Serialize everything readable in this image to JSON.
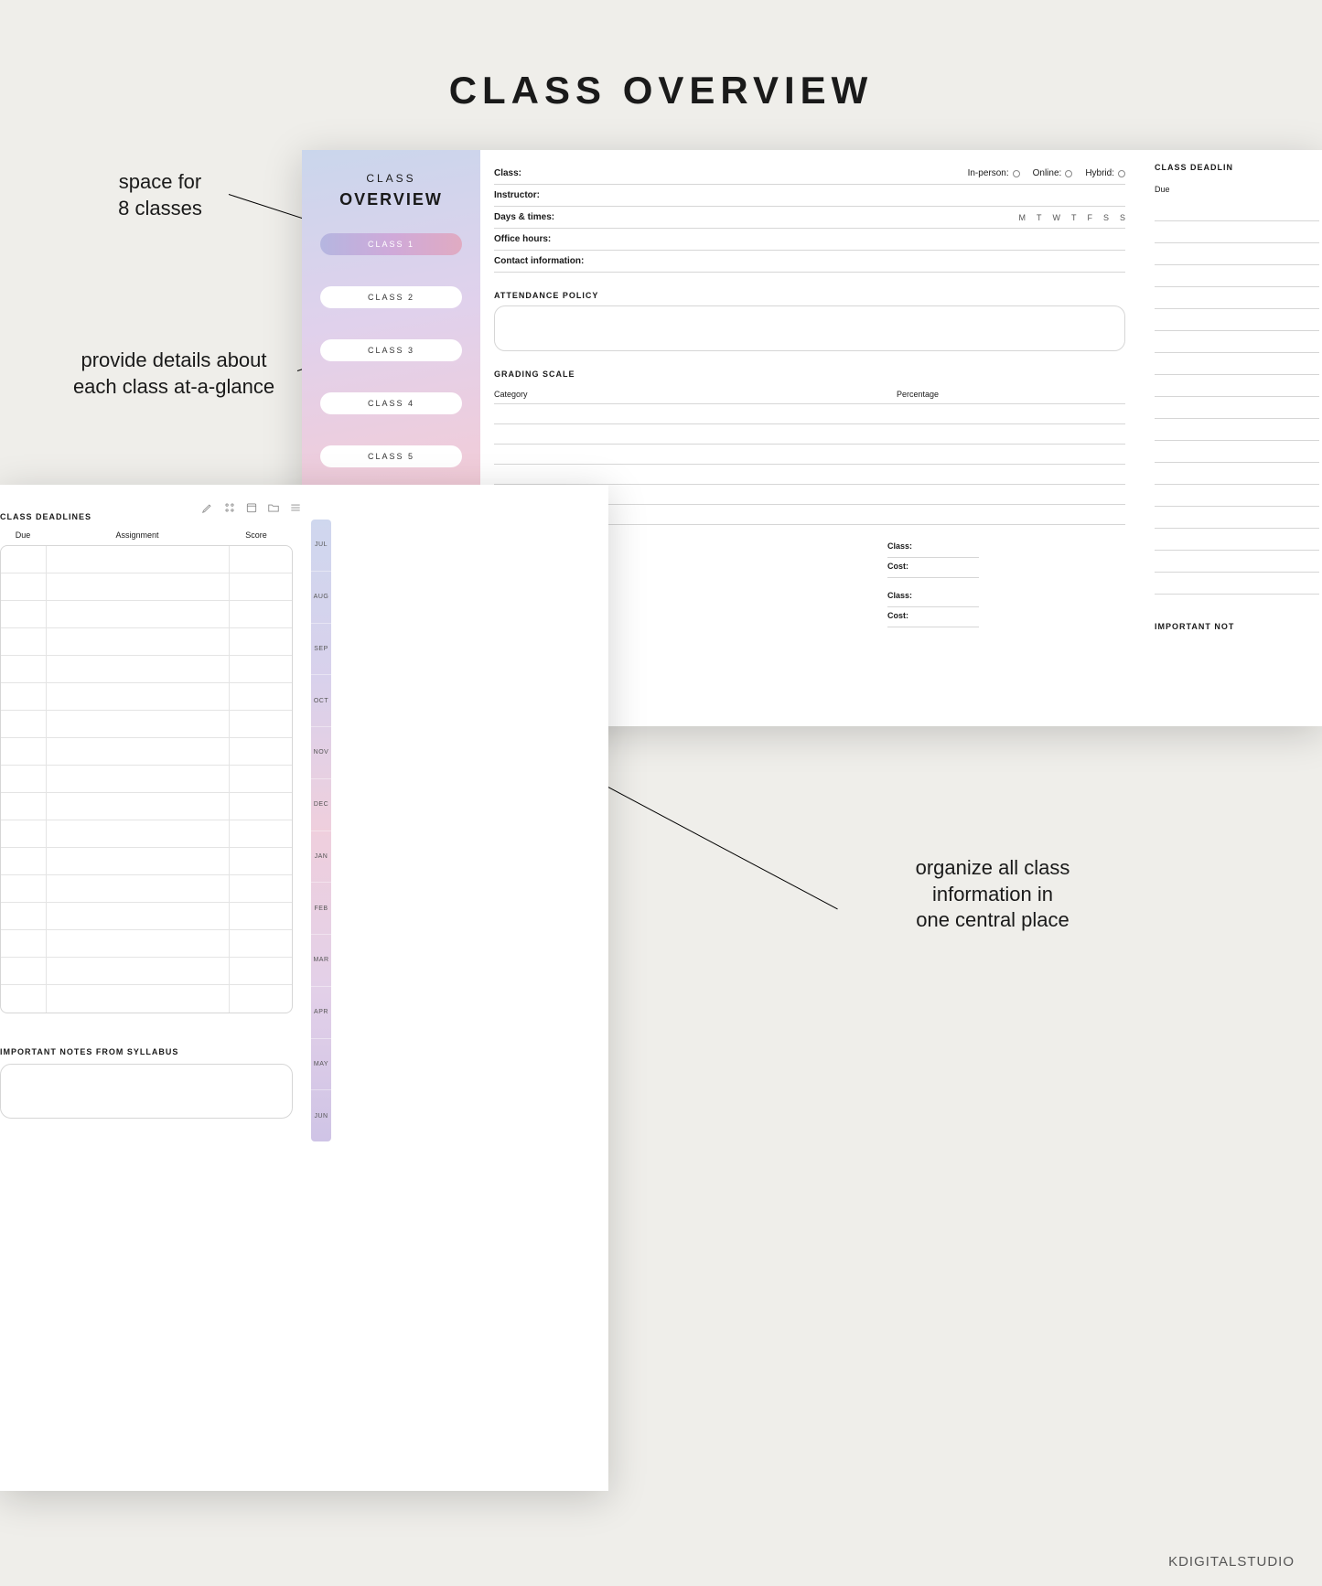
{
  "title": "CLASS OVERVIEW",
  "watermark": "KDIGITALSTUDIO",
  "annotations": {
    "left_top": "space for\n8 classes",
    "left_mid": "provide details about\neach class at-a-glance",
    "right": "organize all class\ninformation in\none central place"
  },
  "sidebar": {
    "subtitle": "CLASS",
    "title": "OVERVIEW",
    "classes": [
      "CLASS 1",
      "CLASS 2",
      "CLASS 3",
      "CLASS 4",
      "CLASS 5"
    ]
  },
  "fields": {
    "class": "Class:",
    "instructor": "Instructor:",
    "days_times": "Days & times:",
    "office": "Office hours:",
    "contact": "Contact information:",
    "attendance": "ATTENDANCE POLICY",
    "grading": "GRADING SCALE",
    "category": "Category",
    "percentage": "Percentage",
    "deadlines": "CLASS DEADLINES",
    "due": "Due",
    "assignment": "Assignment",
    "score": "Score",
    "important_notes": "IMPORTANT NOTES FROM SYLLABUS",
    "important_notes_short": "IMPORTANT NOT",
    "class_deadlin": "CLASS DEADLIN",
    "small_class": "Class:",
    "small_cost": "Cost:"
  },
  "format": {
    "inperson": "In-person:",
    "online": "Online:",
    "hybrid": "Hybrid:"
  },
  "dow": [
    "M",
    "T",
    "W",
    "T",
    "F",
    "S",
    "S"
  ],
  "months": [
    "JUL",
    "AUG",
    "SEP",
    "OCT",
    "NOV",
    "DEC",
    "JAN",
    "FEB",
    "MAR",
    "APR",
    "MAY",
    "JUN"
  ]
}
